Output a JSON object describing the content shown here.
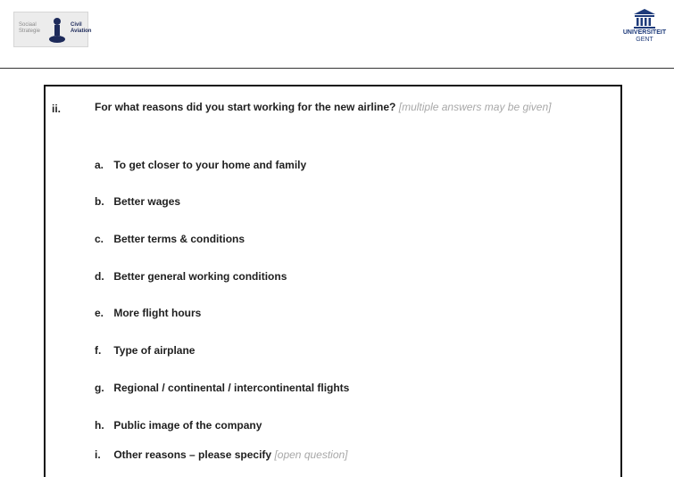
{
  "header": {
    "left_logo": {
      "left_lines": [
        "Sociaal",
        "Strategie"
      ],
      "right_lines": [
        "Civil",
        "Aviation"
      ]
    },
    "right_logo": {
      "line1": "UNIVERSITEIT",
      "line2": "GENT"
    }
  },
  "question": {
    "number": "ii.",
    "text": "For what reasons did you start working for the new airline?",
    "hint": "[multiple answers may be given]",
    "options": [
      {
        "letter": "a.",
        "text": "To get closer to your home and family",
        "hint": ""
      },
      {
        "letter": "b.",
        "text": "Better wages",
        "hint": ""
      },
      {
        "letter": "c.",
        "text": "Better terms & conditions",
        "hint": ""
      },
      {
        "letter": "d.",
        "text": "Better general working conditions",
        "hint": ""
      },
      {
        "letter": "e.",
        "text": "More flight hours",
        "hint": ""
      },
      {
        "letter": "f.",
        "text": "Type of airplane",
        "hint": ""
      },
      {
        "letter": "g.",
        "text": "Regional / continental / intercontinental flights",
        "hint": ""
      },
      {
        "letter": "h.",
        "text": "Public image of the company",
        "hint": ""
      },
      {
        "letter": "i.",
        "text": "Other reasons – please specify",
        "hint": "[open question]"
      }
    ]
  }
}
